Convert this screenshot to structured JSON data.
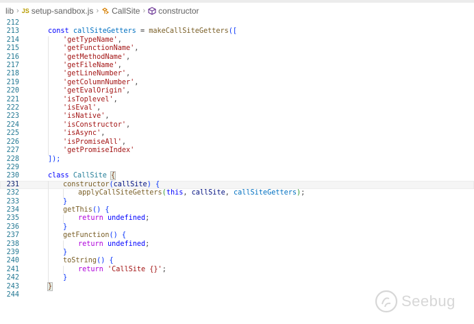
{
  "breadcrumb": {
    "folder": "lib",
    "file_icon_text": "JS",
    "file": "setup-sandbox.js",
    "class": "CallSite",
    "method": "constructor"
  },
  "line_numbers": [
    "212",
    "213",
    "214",
    "215",
    "216",
    "217",
    "218",
    "219",
    "220",
    "221",
    "222",
    "223",
    "224",
    "225",
    "226",
    "227",
    "228",
    "229",
    "230",
    "231",
    "232",
    "233",
    "234",
    "235",
    "236",
    "237",
    "238",
    "239",
    "240",
    "241",
    "242",
    "243",
    "244"
  ],
  "current_line": "231",
  "code": {
    "const": "const",
    "getters_var": "callSiteGetters",
    "equals": " = ",
    "make_fn": "makeCallSiteGetters",
    "open": "([",
    "strings": [
      "'getTypeName'",
      "'getFunctionName'",
      "'getMethodName'",
      "'getFileName'",
      "'getLineNumber'",
      "'getColumnNumber'",
      "'getEvalOrigin'",
      "'isToplevel'",
      "'isEval'",
      "'isNative'",
      "'isConstructor'",
      "'isAsync'",
      "'isPromiseAll'",
      "'getPromiseIndex'"
    ],
    "comma": ",",
    "close": "]);",
    "class_kw": "class",
    "class_name": "CallSite",
    "brace_open": "{",
    "brace_close": "}",
    "ctor": "constructor",
    "ctor_param": "callSite",
    "apply_fn": "applyCallSiteGetters",
    "this_kw": "this",
    "getThis": "getThis",
    "getFunction": "getFunction",
    "toString": "toString",
    "return_kw": "return",
    "undefined_kw": "undefined",
    "callsite_str": "'CallSite {}'"
  },
  "watermark": {
    "text": "Seebug"
  }
}
